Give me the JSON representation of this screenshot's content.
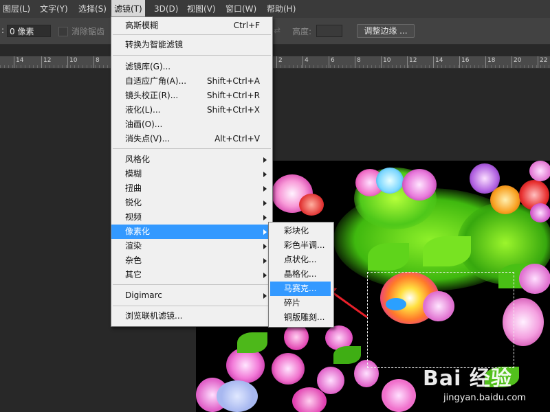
{
  "menubar": {
    "items": [
      {
        "label": "图层(L)"
      },
      {
        "label": "文字(Y)"
      },
      {
        "label": "选择(S)"
      },
      {
        "label": "滤镜(T)",
        "active": true
      },
      {
        "label": "3D(D)"
      },
      {
        "label": "视图(V)"
      },
      {
        "label": "窗口(W)"
      },
      {
        "label": "帮助(H)"
      }
    ]
  },
  "options_bar": {
    "feather_prefix": ":",
    "feather_value": "0 像素",
    "antialias_label": "消除锯齿",
    "height_label": "高度:",
    "height_value": "",
    "refine_edge_button": "调整边缘 ..."
  },
  "ruler": {
    "labels": [
      "14",
      "12",
      "10",
      "8",
      "2",
      "4",
      "6",
      "8",
      "10",
      "12",
      "14",
      "16",
      "18",
      "20",
      "22",
      "24"
    ]
  },
  "filter_menu": {
    "items": [
      {
        "label": "高斯模糊",
        "shortcut": "Ctrl+F"
      },
      {
        "separator": true
      },
      {
        "label": "转换为智能滤镜"
      },
      {
        "separator": true
      },
      {
        "label": "滤镜库(G)..."
      },
      {
        "label": "自适应广角(A)...",
        "shortcut": "Shift+Ctrl+A"
      },
      {
        "label": "镜头校正(R)...",
        "shortcut": "Shift+Ctrl+R"
      },
      {
        "label": "液化(L)...",
        "shortcut": "Shift+Ctrl+X"
      },
      {
        "label": "油画(O)..."
      },
      {
        "label": "消失点(V)...",
        "shortcut": "Alt+Ctrl+V"
      },
      {
        "separator": true
      },
      {
        "label": "风格化",
        "submenu": true
      },
      {
        "label": "模糊",
        "submenu": true
      },
      {
        "label": "扭曲",
        "submenu": true
      },
      {
        "label": "锐化",
        "submenu": true
      },
      {
        "label": "视频",
        "submenu": true
      },
      {
        "label": "像素化",
        "submenu": true,
        "highlighted": true
      },
      {
        "label": "渲染",
        "submenu": true
      },
      {
        "label": "杂色",
        "submenu": true
      },
      {
        "label": "其它",
        "submenu": true
      },
      {
        "separator": true
      },
      {
        "label": "Digimarc",
        "submenu": true
      },
      {
        "separator": true
      },
      {
        "label": "浏览联机滤镜..."
      }
    ]
  },
  "pixelate_submenu": {
    "items": [
      {
        "label": "彩块化"
      },
      {
        "label": "彩色半调..."
      },
      {
        "label": "点状化..."
      },
      {
        "label": "晶格化..."
      },
      {
        "label": "马赛克...",
        "highlighted": true
      },
      {
        "label": "碎片"
      },
      {
        "label": "铜版雕刻..."
      }
    ]
  },
  "watermark": {
    "logo_text": "Bai 经验",
    "url": "jingyan.baidu.com"
  },
  "colors": {
    "highlight": "#3399ff",
    "menu_bg": "#f0f0f0",
    "arrow": "#e8202a"
  }
}
